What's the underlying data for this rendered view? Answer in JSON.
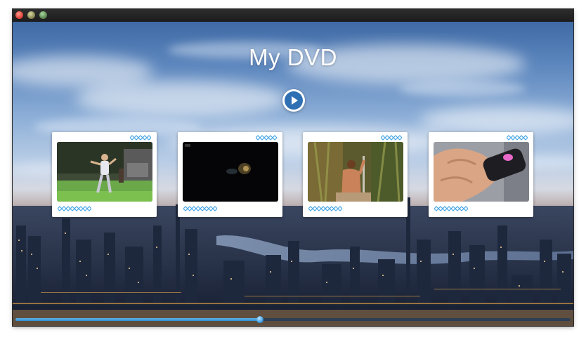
{
  "window": {
    "title": ""
  },
  "menu": {
    "title": "My DVD",
    "play_button_icon": "play-icon"
  },
  "chapters": [
    {
      "name": "chapter-1",
      "thumb_kind": "dance",
      "label": ""
    },
    {
      "name": "chapter-2",
      "thumb_kind": "dark",
      "label": ""
    },
    {
      "name": "chapter-3",
      "thumb_kind": "forest",
      "label": ""
    },
    {
      "name": "chapter-4",
      "thumb_kind": "hand",
      "label": ""
    }
  ],
  "playback": {
    "progress": 0.44
  },
  "colors": {
    "accent": "#4aa8e8",
    "card_bg": "#ffffff",
    "title_text": "#ffffff"
  }
}
